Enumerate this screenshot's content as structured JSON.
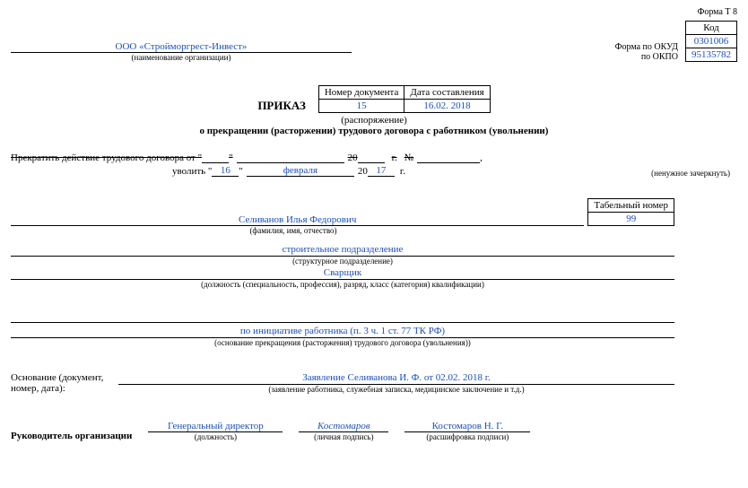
{
  "form_label": "Форма Т 8",
  "org_name": "ООО «Стройморгрест-Инвест»",
  "org_caption": "(наименование организации)",
  "okud_label": "Форма по ОКУД",
  "okpo_label": "по ОКПО",
  "code_header": "Код",
  "okud_code": "0301006",
  "okpo_code": "95135782",
  "title": "ПРИКАЗ",
  "doc_no_header": "Номер документа",
  "doc_date_header": "Дата составления",
  "doc_no": "15",
  "doc_date": "16.02. 2018",
  "subtitle1": "(распоряжение)",
  "subtitle2": "о прекращении (расторжении) трудового договора с работником (увольнении)",
  "terminate_line": "Прекратить действие трудового договора от \"",
  "terminate_day": "",
  "terminate_quote2": "\"",
  "terminate_month": "",
  "terminate_year_prefix": "20",
  "terminate_year": "",
  "g_label": "г.",
  "no_label": "№",
  "contract_no": "",
  "dismiss_label": "уволить \"",
  "dismiss_day": "16",
  "dismiss_quote2": "\"",
  "dismiss_month": "февраля",
  "dismiss_year_prefix": "20",
  "dismiss_year": "17",
  "side_note": "(ненужное зачеркнуть)",
  "tab_header": "Табельный номер",
  "tab_no": "99",
  "emp_name": "Селиванов Илья Федорович",
  "emp_name_caption": "(фамилия, имя, отчество)",
  "dept": "строительное подразделение",
  "dept_caption": "(структурное подразделение)",
  "position": "Сварщик",
  "position_caption": "(должность (специальность, профессия), разряд, класс (категория) квалификации)",
  "reason": "по инициативе работника (п. 3 ч. 1 ст. 77 ТК РФ)",
  "reason_caption": "(основание прекращения (расторжения) трудового договора (увольнения))",
  "basis_label1": "Основание (документ,",
  "basis_label2": "номер, дата):",
  "basis_text": "Заявление Селиванова И. Ф. от 02.02. 2018 г.",
  "basis_caption": "(заявление работника, служебная записка, медицинское заключение и т.д.)",
  "head_label": "Руководитель организации",
  "head_position": "Генеральный директор",
  "head_pos_caption": "(должность)",
  "head_sign": "Костомаров",
  "head_sign_caption": "(личная подпись)",
  "head_decipher": "Костомаров Н. Г.",
  "head_decipher_caption": "(расшифровка подписи)"
}
